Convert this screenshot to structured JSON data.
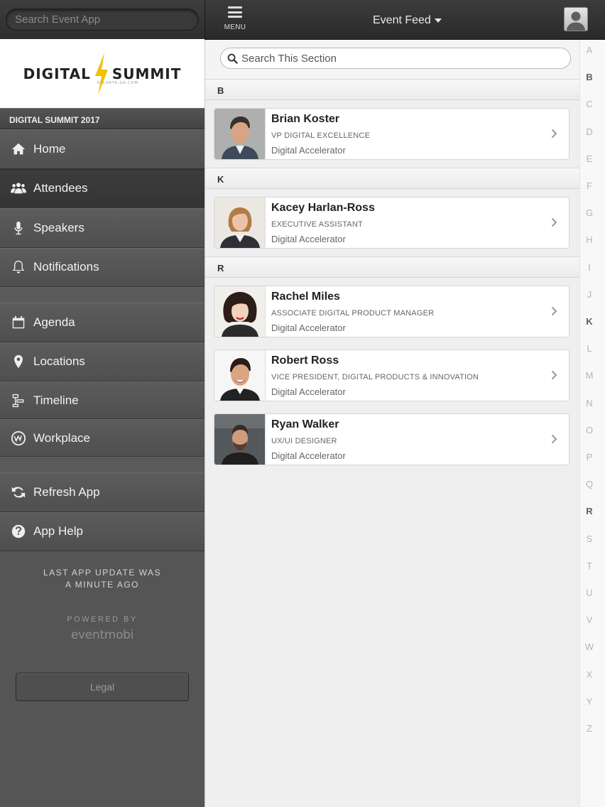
{
  "sidebar": {
    "search_placeholder": "Search Event App",
    "logo": {
      "left": "DIGITAL",
      "right": "SUMMIT",
      "sub": "ATLANTA.GA.COM"
    },
    "section_title": "DIGITAL SUMMIT 2017",
    "nav_group_1": [
      {
        "label": "Home",
        "icon": "home-icon"
      },
      {
        "label": "Attendees",
        "icon": "users-icon",
        "active": true
      },
      {
        "label": "Speakers",
        "icon": "microphone-icon"
      },
      {
        "label": "Notifications",
        "icon": "bell-icon"
      }
    ],
    "nav_group_2": [
      {
        "label": "Agenda",
        "icon": "calendar-icon"
      },
      {
        "label": "Locations",
        "icon": "map-pin-icon"
      },
      {
        "label": "Timeline",
        "icon": "timeline-icon"
      },
      {
        "label": "Workplace",
        "icon": "workplace-icon"
      }
    ],
    "nav_group_3": [
      {
        "label": "Refresh App",
        "icon": "refresh-icon"
      },
      {
        "label": "App Help",
        "icon": "help-icon"
      }
    ],
    "update_line_1": "LAST APP UPDATE WAS",
    "update_line_2": "A MINUTE AGO",
    "powered_by": "POWERED BY",
    "brand": "eventmobi",
    "legal_label": "Legal"
  },
  "header": {
    "menu_label": "MENU",
    "feed_title": "Event Feed"
  },
  "content": {
    "search_placeholder": "Search This Section",
    "groups": [
      {
        "letter": "B",
        "people": [
          {
            "name": "Brian Koster",
            "title": "VP DIGITAL EXCELLENCE",
            "company": "Digital Accelerator"
          }
        ]
      },
      {
        "letter": "K",
        "people": [
          {
            "name": "Kacey Harlan-Ross",
            "title": "EXECUTIVE ASSISTANT",
            "company": "Digital Accelerator"
          }
        ]
      },
      {
        "letter": "R",
        "people": [
          {
            "name": "Rachel Miles",
            "title": "ASSOCIATE DIGITAL PRODUCT MANAGER",
            "company": "Digital Accelerator"
          },
          {
            "name": "Robert Ross",
            "title": "VICE PRESIDENT, DIGITAL PRODUCTS & INNOVATION",
            "company": "Digital Accelerator"
          },
          {
            "name": "Ryan Walker",
            "title": "UX/UI DESIGNER",
            "company": "Digital Accelerator"
          }
        ]
      }
    ]
  },
  "alphabet": [
    "A",
    "B",
    "C",
    "D",
    "E",
    "F",
    "G",
    "H",
    "I",
    "J",
    "K",
    "L",
    "M",
    "N",
    "O",
    "P",
    "Q",
    "R",
    "S",
    "T",
    "U",
    "V",
    "W",
    "X",
    "Y",
    "Z"
  ],
  "alphabet_active": [
    "B",
    "K",
    "R"
  ],
  "colors": {
    "logo_bolt": "#f2c200",
    "sidebar_bg": "#555555",
    "header_bg": "#333333"
  }
}
